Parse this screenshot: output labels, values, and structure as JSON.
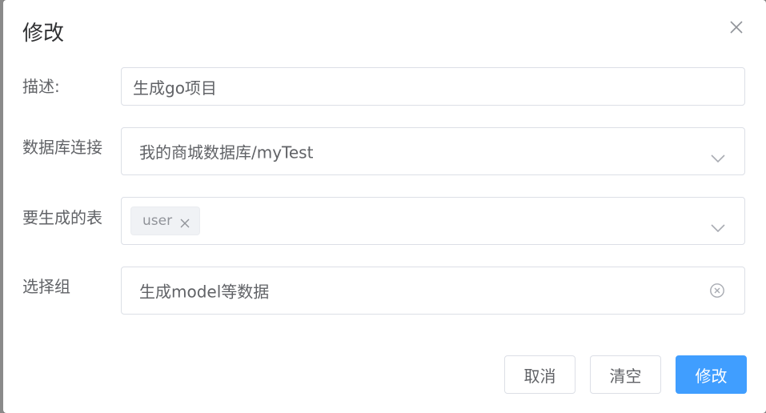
{
  "dialog": {
    "title": "修改"
  },
  "form": {
    "description": {
      "label": "描述:",
      "value": "生成go项目"
    },
    "db_connection": {
      "label": "数据库连接",
      "value": "我的商城数据库/myTest"
    },
    "tables": {
      "label": "要生成的表",
      "tags": [
        "user"
      ]
    },
    "group": {
      "label": "选择组",
      "value": "生成model等数据"
    }
  },
  "footer": {
    "cancel_label": "取消",
    "clear_label": "清空",
    "submit_label": "修改"
  },
  "colors": {
    "primary": "#409eff",
    "border": "#dcdfe6",
    "text": "#606266"
  },
  "icons": {
    "close": "close-icon",
    "dropdown": "chevron-down-icon",
    "tag_close": "close-icon",
    "clear": "circle-close-icon"
  }
}
